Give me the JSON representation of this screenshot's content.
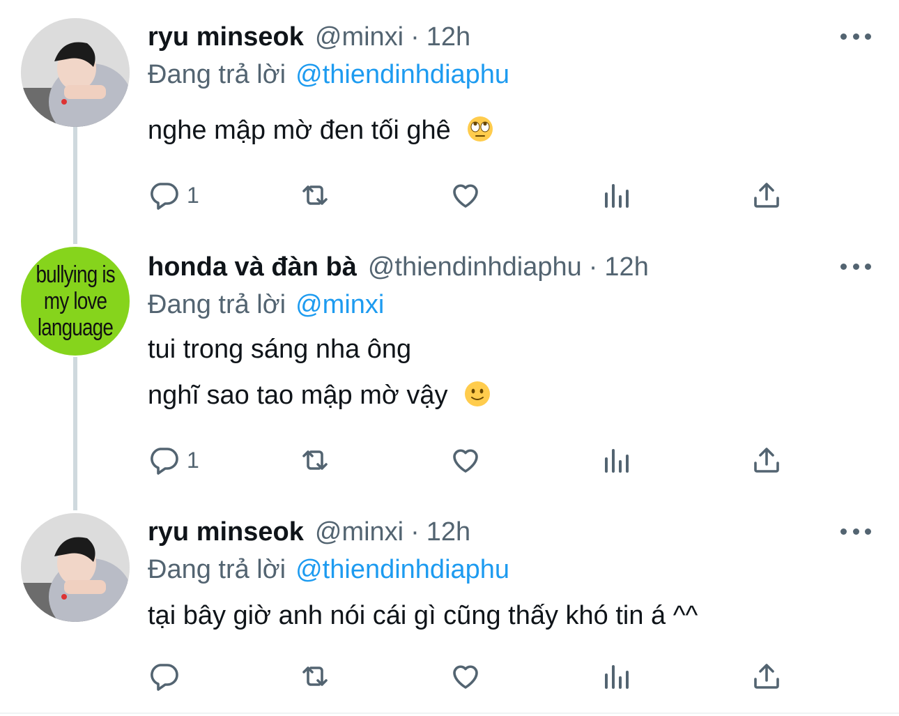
{
  "colors": {
    "accent": "#1d9bf0",
    "secondary_text": "#536471",
    "thread_line": "#cfd9de",
    "green_avatar": "#86d41c"
  },
  "tweets": [
    {
      "name": "ryu minseok",
      "handle": "@minxi",
      "dot": "·",
      "time": "12h",
      "replying_prefix": "Đang trả lời",
      "replying_to": "@thiendinhdiaphu",
      "lines": [
        "nghe mập mờ đen tối ghê"
      ],
      "emoji": "face-with-rolling-eyes",
      "reply_count": "1",
      "avatar": "photo-boy"
    },
    {
      "name": "honda và đàn bà",
      "handle": "@thiendinhdiaphu",
      "dot": "·",
      "time": "12h",
      "replying_prefix": "Đang trả lời",
      "replying_to": "@minxi",
      "lines": [
        "tui trong sáng nha ông",
        "nghĩ sao tao mập mờ vậy"
      ],
      "emoji": "slightly-smiling-face",
      "reply_count": "1",
      "avatar_text": [
        "bullying is",
        "my love",
        "language"
      ]
    },
    {
      "name": "ryu minseok",
      "handle": "@minxi",
      "dot": "·",
      "time": "12h",
      "replying_prefix": "Đang trả lời",
      "replying_to": "@thiendinhdiaphu",
      "lines": [
        "tại bây giờ anh nói cái gì cũng thấy khó tin á ^^"
      ],
      "reply_count": "",
      "avatar": "photo-boy"
    }
  ]
}
